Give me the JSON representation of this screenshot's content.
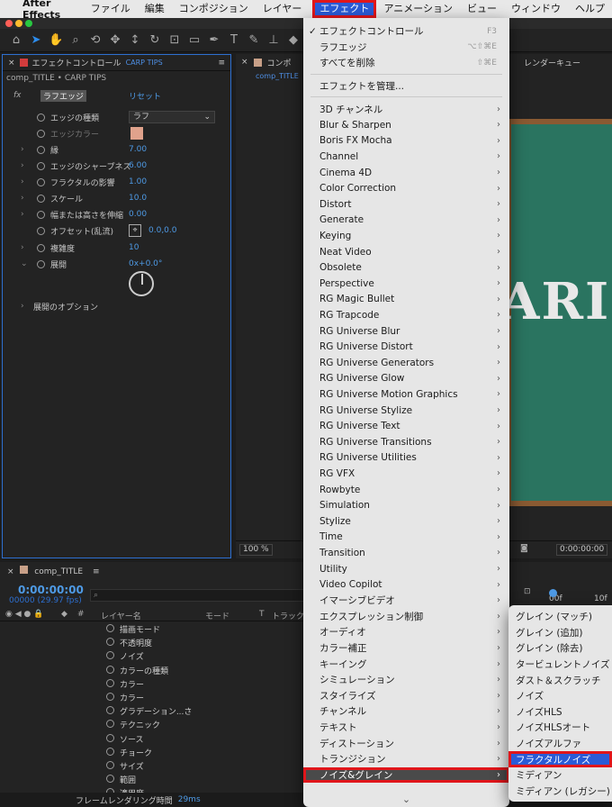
{
  "menubar": {
    "app": "After Effects",
    "items": [
      "ファイル",
      "編集",
      "コンポジション",
      "レイヤー",
      "エフェクト",
      "アニメーション",
      "ビュー",
      "ウィンドウ",
      "ヘルプ"
    ],
    "active": "エフェクト"
  },
  "effect_panel": {
    "title": "エフェクトコントロール",
    "subtitle": "CARP TIPS",
    "comp_name": "comp_TITLE • CARP TIPS",
    "effect_name": "ラフエッジ",
    "reset": "リセット",
    "params": [
      {
        "name": "エッジの種類",
        "value": "ラフ"
      },
      {
        "name": "エッジカラー",
        "value": ""
      },
      {
        "name": "縁",
        "value": "7.00"
      },
      {
        "name": "エッジのシャープネス",
        "value": "6.00"
      },
      {
        "name": "フラクタルの影響",
        "value": "1.00"
      },
      {
        "name": "スケール",
        "value": "10.0"
      },
      {
        "name": "幅または高さを伸縮",
        "value": "0.00"
      },
      {
        "name": "オフセット(乱流)",
        "value": "0.0,0.0"
      },
      {
        "name": "複雑度",
        "value": "10"
      },
      {
        "name": "展開",
        "value": "0x+0.0°"
      }
    ],
    "evolution_options": "展開のオプション",
    "edge_color": "#e0a28c"
  },
  "comp_panel": {
    "tab_prefix": "コンポ",
    "comp_tab": "comp_TITLE",
    "render_queue": "レンダーキュー",
    "board_text": "ARI",
    "zoom": "100 %",
    "time": "0:00:00:00"
  },
  "timeline": {
    "title": "comp_TITLE",
    "timecode": "0:00:00:00",
    "fps": "00000 (29.97 fps)",
    "col_layer": "レイヤー名",
    "col_mode": "モード",
    "col_t": "T",
    "col_track": "トラック",
    "ruler": [
      "00f",
      "10f"
    ],
    "rows": [
      "描画モード",
      "不透明度",
      "ノイズ",
      "カラーの種類",
      "カラー",
      "カラー",
      "グラデーション...さ",
      "テクニック",
      "ソース",
      "チョーク",
      "サイズ",
      "範囲",
      "適用度"
    ],
    "status_label": "フレームレンダリング時間",
    "status_ms": "29ms"
  },
  "effect_menu": {
    "items": [
      {
        "label": "エフェクトコントロール",
        "shortcut": "F3",
        "checked": true
      },
      {
        "label": "ラフエッジ",
        "shortcut": "⌥⇧⌘E"
      },
      {
        "label": "すべてを削除",
        "shortcut": "⇧⌘E"
      },
      {
        "label": "エフェクトを管理..."
      },
      {
        "label": "3D チャンネル",
        "sub": true
      },
      {
        "label": "Blur & Sharpen",
        "sub": true
      },
      {
        "label": "Boris FX Mocha",
        "sub": true
      },
      {
        "label": "Channel",
        "sub": true
      },
      {
        "label": "Cinema 4D",
        "sub": true
      },
      {
        "label": "Color Correction",
        "sub": true
      },
      {
        "label": "Distort",
        "sub": true
      },
      {
        "label": "Generate",
        "sub": true
      },
      {
        "label": "Keying",
        "sub": true
      },
      {
        "label": "Neat Video",
        "sub": true
      },
      {
        "label": "Obsolete",
        "sub": true
      },
      {
        "label": "Perspective",
        "sub": true
      },
      {
        "label": "RG Magic Bullet",
        "sub": true
      },
      {
        "label": "RG Trapcode",
        "sub": true
      },
      {
        "label": "RG Universe Blur",
        "sub": true
      },
      {
        "label": "RG Universe Distort",
        "sub": true
      },
      {
        "label": "RG Universe Generators",
        "sub": true
      },
      {
        "label": "RG Universe Glow",
        "sub": true
      },
      {
        "label": "RG Universe Motion Graphics",
        "sub": true
      },
      {
        "label": "RG Universe Stylize",
        "sub": true
      },
      {
        "label": "RG Universe Text",
        "sub": true
      },
      {
        "label": "RG Universe Transitions",
        "sub": true
      },
      {
        "label": "RG Universe Utilities",
        "sub": true
      },
      {
        "label": "RG VFX",
        "sub": true
      },
      {
        "label": "Rowbyte",
        "sub": true
      },
      {
        "label": "Simulation",
        "sub": true
      },
      {
        "label": "Stylize",
        "sub": true
      },
      {
        "label": "Time",
        "sub": true
      },
      {
        "label": "Transition",
        "sub": true
      },
      {
        "label": "Utility",
        "sub": true
      },
      {
        "label": "Video Copilot",
        "sub": true
      },
      {
        "label": "イマーシブビデオ",
        "sub": true
      },
      {
        "label": "エクスプレッション制御",
        "sub": true
      },
      {
        "label": "オーディオ",
        "sub": true
      },
      {
        "label": "カラー補正",
        "sub": true
      },
      {
        "label": "キーイング",
        "sub": true
      },
      {
        "label": "シミュレーション",
        "sub": true
      },
      {
        "label": "スタイライズ",
        "sub": true
      },
      {
        "label": "チャンネル",
        "sub": true
      },
      {
        "label": "テキスト",
        "sub": true
      },
      {
        "label": "ディストーション",
        "sub": true
      },
      {
        "label": "トランジション",
        "sub": true
      },
      {
        "label": "ノイズ&グレイン",
        "sub": true,
        "highlight": true
      }
    ]
  },
  "noise_submenu": {
    "items": [
      "グレイン (マッチ)",
      "グレイン (追加)",
      "グレイン (除去)",
      "タービュレントノイズ",
      "ダスト＆スクラッチ",
      "ノイズ",
      "ノイズHLS",
      "ノイズHLSオート",
      "ノイズアルファ",
      "フラクタルノイズ",
      "ミディアン",
      "ミディアン (レガシー)"
    ],
    "selected": "フラクタルノイズ"
  },
  "colors": {
    "accent": "#2a5bd7",
    "highlight_border": "#e0161b",
    "link": "#4e9ae5"
  }
}
